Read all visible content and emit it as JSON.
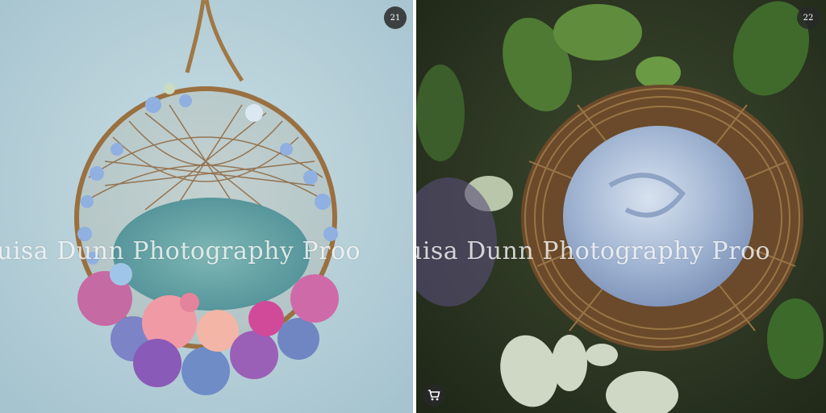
{
  "gallery": {
    "items": [
      {
        "index_label": "21",
        "watermark": "uisa Dunn Photography Proo"
      },
      {
        "index_label": "22",
        "watermark": "uisa Dunn Photography Proo"
      }
    ],
    "cart_icon": "shopping-cart-icon"
  }
}
